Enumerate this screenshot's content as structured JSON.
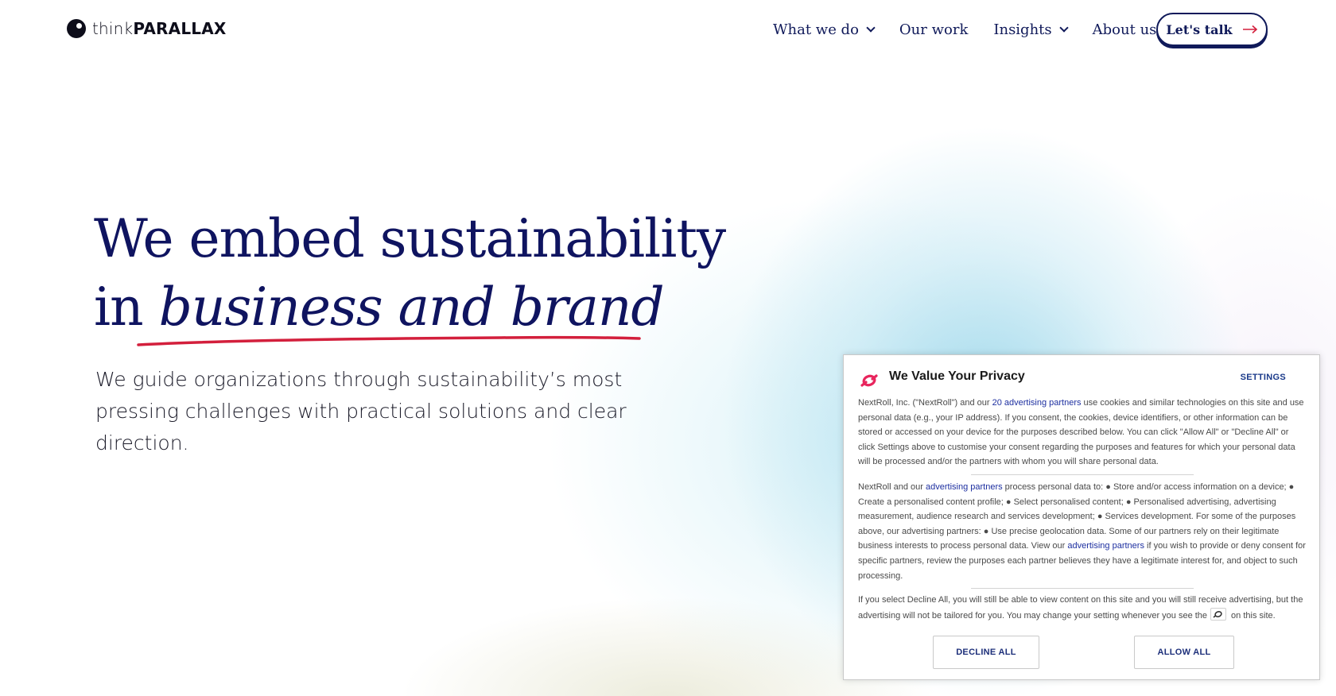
{
  "brand": {
    "logo_light": "think",
    "logo_bold": "PARALLAX"
  },
  "nav": {
    "items": [
      {
        "label": "What we do",
        "has_dropdown": true
      },
      {
        "label": "Our work",
        "has_dropdown": false
      },
      {
        "label": "Insights",
        "has_dropdown": true
      },
      {
        "label": "About us",
        "has_dropdown": false
      }
    ],
    "cta_label": "Let's talk",
    "cta_icon": "arrow-right-icon"
  },
  "hero": {
    "title_line1": "We embed sustainability",
    "title_line2_prefix": "in ",
    "title_line2_emphasis": "business and brand",
    "subtitle": "We guide organizations through sustainability’s most pressing challenges with practical solutions and clear direction."
  },
  "colors": {
    "navy": "#0f1460",
    "accent_red": "#d31f3c",
    "cookie_link": "#1d2fa0",
    "nextroll_pink": "#e8255d"
  },
  "cookie": {
    "title": "We Value Your Privacy",
    "settings_label": "SETTINGS",
    "p1": {
      "before": "NextRoll, Inc. (\"NextRoll\") and our ",
      "link": "20 advertising partners",
      "after": " use cookies and similar technologies on this site and use personal data (e.g., your IP address). If you consent, the cookies, device identifiers, or other information can be stored or accessed on your device for the purposes described below. You can click \"Allow All\" or \"Decline All\" or click Settings above to customise your consent regarding the purposes and features for which your personal data will be processed and/or the partners with whom you will share personal data."
    },
    "p2": {
      "before": "NextRoll and our ",
      "link1": "advertising partners",
      "middle": " process personal data to: ● Store and/or access information on a device; ● Create a personalised content profile; ● Select personalised content; ● Personalised advertising, advertising measurement, audience research and services development; ● Services development. For some of the purposes above, our advertising partners: ● Use precise geolocation data. Some of our partners rely on their legitimate business interests to process personal data. View our ",
      "link2": "advertising partners",
      "after": " if you wish to provide or deny consent for specific partners, review the purposes each partner believes they have a legitimate interest for, and object to such processing."
    },
    "p3": {
      "before": "If you select Decline All, you will still be able to view content on this site and you will still receive advertising, but the advertising will not be tailored for you. You may change your setting whenever you see the",
      "after": "on this site."
    },
    "decline_label": "DECLINE ALL",
    "allow_label": "ALLOW ALL"
  }
}
